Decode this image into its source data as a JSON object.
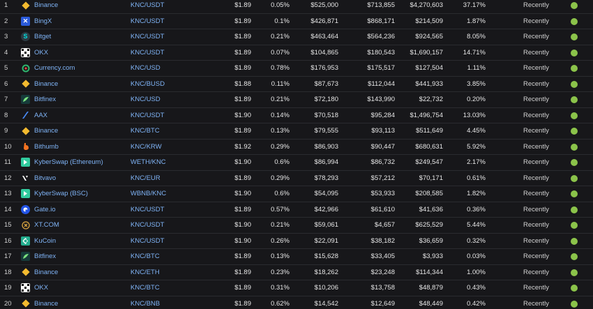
{
  "colors": {
    "background": "#17171a",
    "link": "#7fb3f5",
    "trust_green": "#8bc34a",
    "row_border": "#2a2b2f"
  },
  "rows": [
    {
      "rank": "1",
      "exchange": "Binance",
      "icon": "binance-icon",
      "pair": "KNC/USDT",
      "price": "$1.89",
      "spread": "0.05%",
      "depth_plus": "$525,000",
      "depth_minus": "$713,855",
      "volume": "$4,270,603",
      "volume_pct": "37.17%",
      "updated": "Recently",
      "trust": "green"
    },
    {
      "rank": "2",
      "exchange": "BingX",
      "icon": "bingx-icon",
      "pair": "KNC/USDT",
      "price": "$1.89",
      "spread": "0.1%",
      "depth_plus": "$426,871",
      "depth_minus": "$868,171",
      "volume": "$214,509",
      "volume_pct": "1.87%",
      "updated": "Recently",
      "trust": "green"
    },
    {
      "rank": "3",
      "exchange": "Bitget",
      "icon": "bitget-icon",
      "pair": "KNC/USDT",
      "price": "$1.89",
      "spread": "0.21%",
      "depth_plus": "$463,464",
      "depth_minus": "$564,236",
      "volume": "$924,565",
      "volume_pct": "8.05%",
      "updated": "Recently",
      "trust": "green"
    },
    {
      "rank": "4",
      "exchange": "OKX",
      "icon": "okx-icon",
      "pair": "KNC/USDT",
      "price": "$1.89",
      "spread": "0.07%",
      "depth_plus": "$104,865",
      "depth_minus": "$180,543",
      "volume": "$1,690,157",
      "volume_pct": "14.71%",
      "updated": "Recently",
      "trust": "green"
    },
    {
      "rank": "5",
      "exchange": "Currency.com",
      "icon": "currency-com-icon",
      "pair": "KNC/USD",
      "price": "$1.89",
      "spread": "0.78%",
      "depth_plus": "$176,953",
      "depth_minus": "$175,517",
      "volume": "$127,504",
      "volume_pct": "1.11%",
      "updated": "Recently",
      "trust": "green"
    },
    {
      "rank": "6",
      "exchange": "Binance",
      "icon": "binance-icon",
      "pair": "KNC/BUSD",
      "price": "$1.88",
      "spread": "0.11%",
      "depth_plus": "$87,673",
      "depth_minus": "$112,044",
      "volume": "$441,933",
      "volume_pct": "3.85%",
      "updated": "Recently",
      "trust": "green"
    },
    {
      "rank": "7",
      "exchange": "Bitfinex",
      "icon": "bitfinex-icon",
      "pair": "KNC/USD",
      "price": "$1.89",
      "spread": "0.21%",
      "depth_plus": "$72,180",
      "depth_minus": "$143,990",
      "volume": "$22,732",
      "volume_pct": "0.20%",
      "updated": "Recently",
      "trust": "green"
    },
    {
      "rank": "8",
      "exchange": "AAX",
      "icon": "aax-icon",
      "pair": "KNC/USDT",
      "price": "$1.90",
      "spread": "0.14%",
      "depth_plus": "$70,518",
      "depth_minus": "$95,284",
      "volume": "$1,496,754",
      "volume_pct": "13.03%",
      "updated": "Recently",
      "trust": "green"
    },
    {
      "rank": "9",
      "exchange": "Binance",
      "icon": "binance-icon",
      "pair": "KNC/BTC",
      "price": "$1.89",
      "spread": "0.13%",
      "depth_plus": "$79,555",
      "depth_minus": "$93,113",
      "volume": "$511,649",
      "volume_pct": "4.45%",
      "updated": "Recently",
      "trust": "green"
    },
    {
      "rank": "10",
      "exchange": "Bithumb",
      "icon": "bithumb-icon",
      "pair": "KNC/KRW",
      "price": "$1.92",
      "spread": "0.29%",
      "depth_plus": "$86,903",
      "depth_minus": "$90,447",
      "volume": "$680,631",
      "volume_pct": "5.92%",
      "updated": "Recently",
      "trust": "green"
    },
    {
      "rank": "11",
      "exchange": "KyberSwap (Ethereum)",
      "icon": "kyberswap-icon",
      "pair": "WETH/KNC",
      "price": "$1.90",
      "spread": "0.6%",
      "depth_plus": "$86,994",
      "depth_minus": "$86,732",
      "volume": "$249,547",
      "volume_pct": "2.17%",
      "updated": "Recently",
      "trust": "green"
    },
    {
      "rank": "12",
      "exchange": "Bitvavo",
      "icon": "bitvavo-icon",
      "pair": "KNC/EUR",
      "price": "$1.89",
      "spread": "0.29%",
      "depth_plus": "$78,293",
      "depth_minus": "$57,212",
      "volume": "$70,171",
      "volume_pct": "0.61%",
      "updated": "Recently",
      "trust": "green"
    },
    {
      "rank": "13",
      "exchange": "KyberSwap (BSC)",
      "icon": "kyberswap-icon",
      "pair": "WBNB/KNC",
      "price": "$1.90",
      "spread": "0.6%",
      "depth_plus": "$54,095",
      "depth_minus": "$53,933",
      "volume": "$208,585",
      "volume_pct": "1.82%",
      "updated": "Recently",
      "trust": "green"
    },
    {
      "rank": "14",
      "exchange": "Gate.io",
      "icon": "gate-io-icon",
      "pair": "KNC/USDT",
      "price": "$1.89",
      "spread": "0.57%",
      "depth_plus": "$42,966",
      "depth_minus": "$61,610",
      "volume": "$41,636",
      "volume_pct": "0.36%",
      "updated": "Recently",
      "trust": "green"
    },
    {
      "rank": "15",
      "exchange": "XT.COM",
      "icon": "xt-com-icon",
      "pair": "KNC/USDT",
      "price": "$1.90",
      "spread": "0.21%",
      "depth_plus": "$59,061",
      "depth_minus": "$4,657",
      "volume": "$625,529",
      "volume_pct": "5.44%",
      "updated": "Recently",
      "trust": "green"
    },
    {
      "rank": "16",
      "exchange": "KuCoin",
      "icon": "kucoin-icon",
      "pair": "KNC/USDT",
      "price": "$1.90",
      "spread": "0.26%",
      "depth_plus": "$22,091",
      "depth_minus": "$38,182",
      "volume": "$36,659",
      "volume_pct": "0.32%",
      "updated": "Recently",
      "trust": "green"
    },
    {
      "rank": "17",
      "exchange": "Bitfinex",
      "icon": "bitfinex-icon",
      "pair": "KNC/BTC",
      "price": "$1.89",
      "spread": "0.13%",
      "depth_plus": "$15,628",
      "depth_minus": "$33,405",
      "volume": "$3,933",
      "volume_pct": "0.03%",
      "updated": "Recently",
      "trust": "green"
    },
    {
      "rank": "18",
      "exchange": "Binance",
      "icon": "binance-icon",
      "pair": "KNC/ETH",
      "price": "$1.89",
      "spread": "0.23%",
      "depth_plus": "$18,262",
      "depth_minus": "$23,248",
      "volume": "$114,344",
      "volume_pct": "1.00%",
      "updated": "Recently",
      "trust": "green"
    },
    {
      "rank": "19",
      "exchange": "OKX",
      "icon": "okx-icon",
      "pair": "KNC/BTC",
      "price": "$1.89",
      "spread": "0.31%",
      "depth_plus": "$10,206",
      "depth_minus": "$13,758",
      "volume": "$48,879",
      "volume_pct": "0.43%",
      "updated": "Recently",
      "trust": "green"
    },
    {
      "rank": "20",
      "exchange": "Binance",
      "icon": "binance-icon",
      "pair": "KNC/BNB",
      "price": "$1.89",
      "spread": "0.62%",
      "depth_plus": "$14,542",
      "depth_minus": "$12,649",
      "volume": "$48,449",
      "volume_pct": "0.42%",
      "updated": "Recently",
      "trust": "green"
    }
  ]
}
